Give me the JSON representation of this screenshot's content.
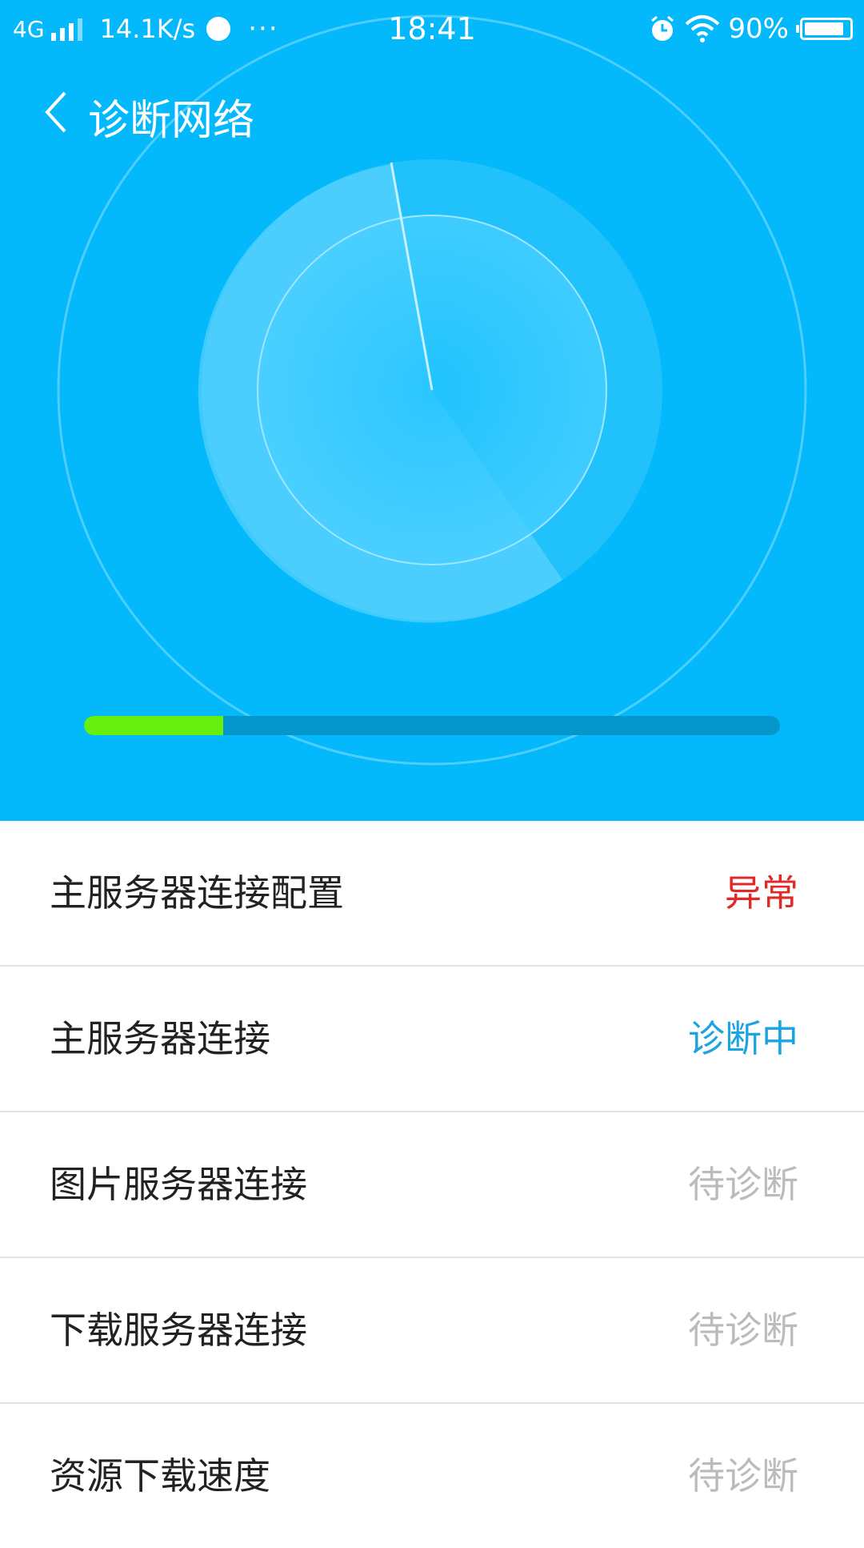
{
  "status_bar": {
    "network": "4G",
    "speed": "14.1K/s",
    "more": "···",
    "time": "18:41",
    "battery_percent": "90%",
    "battery_level": 0.9,
    "icons": [
      "signal-icon",
      "sync-icon",
      "alarm-icon",
      "wifi-icon",
      "battery-icon"
    ]
  },
  "header": {
    "title": "诊断网络"
  },
  "diagnosis": {
    "progress": 0.2
  },
  "colors": {
    "header_bg": "#03b9fb",
    "progress_fill": "#67f00f",
    "progress_track": "#0597cc",
    "status_error": "#e02a2a",
    "status_running": "#1aa4e0",
    "status_pending": "#bbbbbb"
  },
  "checks": [
    {
      "label": "主服务器连接配置",
      "status": "异常",
      "state": "error"
    },
    {
      "label": "主服务器连接",
      "status": "诊断中",
      "state": "running"
    },
    {
      "label": "图片服务器连接",
      "status": "待诊断",
      "state": "pending"
    },
    {
      "label": "下载服务器连接",
      "status": "待诊断",
      "state": "pending"
    },
    {
      "label": "资源下载速度",
      "status": "待诊断",
      "state": "pending"
    }
  ]
}
